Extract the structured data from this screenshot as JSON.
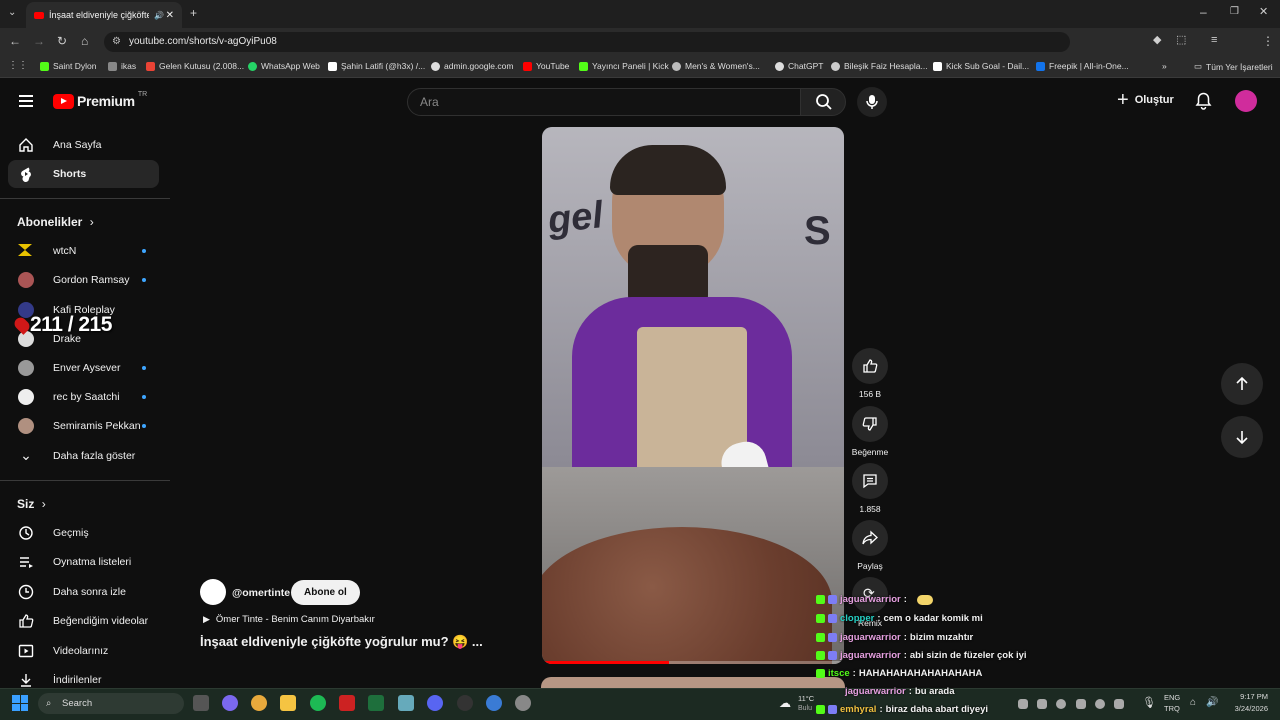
{
  "browser": {
    "tab_title": "İnşaat eldiveniyle çiğköfte y",
    "url": "youtube.com/shorts/v-agOyiPu08",
    "bookmarks": [
      {
        "label": "Saint Dylon",
        "color": "#53fc18"
      },
      {
        "label": "ikas",
        "color": "#888888"
      },
      {
        "label": "Gelen Kutusu (2.008...",
        "color": "#ea4335"
      },
      {
        "label": "WhatsApp Web",
        "color": "#25d366"
      },
      {
        "label": "Şahin Latifi (@h3x) /...",
        "color": "#ffffff"
      },
      {
        "label": "admin.google.com",
        "color": "#dddddd"
      },
      {
        "label": "YouTube",
        "color": "#ff0000"
      },
      {
        "label": "Yayıncı Paneli | Kick",
        "color": "#53fc18"
      },
      {
        "label": "Men's & Women's...",
        "color": "#bbbbbb"
      },
      {
        "label": "ChatGPT",
        "color": "#dddddd"
      },
      {
        "label": "Bileşik Faiz Hesapla...",
        "color": "#cccccc"
      },
      {
        "label": "Kick Sub Goal - Dail...",
        "color": "#ffffff"
      },
      {
        "label": "Freepik | All-in-One...",
        "color": "#1273eb"
      }
    ],
    "all_bookmarks": "Tüm Yer İşaretleri"
  },
  "header": {
    "logo": "Premium",
    "logo_region": "TR",
    "search_placeholder": "Ara",
    "create_label": "Oluştur"
  },
  "sidebar": {
    "main": [
      {
        "label": "Ana Sayfa",
        "icon": "home-icon"
      },
      {
        "label": "Shorts",
        "icon": "shorts-icon",
        "active": true
      }
    ],
    "subs_title": "Abonelikler",
    "subscriptions": [
      {
        "label": "wtcN",
        "dot": true,
        "color": "#e8c200"
      },
      {
        "label": "Gordon Ramsay",
        "dot": true,
        "color": "#a55"
      },
      {
        "label": "Kafi Roleplay",
        "dot": false,
        "color": "#333a88"
      },
      {
        "label": "Drake",
        "dot": false,
        "color": "#ddd"
      },
      {
        "label": "Enver Aysever",
        "dot": true,
        "color": "#999"
      },
      {
        "label": "rec by Saatchi",
        "dot": true,
        "color": "#eee"
      },
      {
        "label": "Semiramis Pekkan",
        "dot": true,
        "color": "#b09080"
      }
    ],
    "show_more": "Daha fazla göster",
    "you_title": "Siz",
    "you_items": [
      {
        "label": "Geçmiş",
        "icon": "history-icon"
      },
      {
        "label": "Oynatma listeleri",
        "icon": "playlist-icon"
      },
      {
        "label": "Daha sonra izle",
        "icon": "clock-icon"
      },
      {
        "label": "Beğendiğim videolar",
        "icon": "thumbs-up-icon"
      },
      {
        "label": "Videolarınız",
        "icon": "video-icon"
      },
      {
        "label": "İndirilenler",
        "icon": "download-icon"
      }
    ]
  },
  "overlay_counter": "211 / 215",
  "video": {
    "channel": "@omertinte",
    "subscribe": "Abone ol",
    "sound": "Ömer Tinte - Benim Canım Diyarbakır",
    "title": "İnşaat eldiveniyle çiğköfte yoğrulur mu? 😝 ...",
    "progress": 0.42,
    "likes": "156 B",
    "dislike_label": "Beğenme",
    "comments": "1.858",
    "share_label": "Paylaş",
    "remix_label": "Remix"
  },
  "chat": [
    {
      "user": "jaguarwarrior",
      "msg": "",
      "user_color": "#e6a0e0"
    },
    {
      "user": "clopper",
      "msg": "cem o kadar komik mi",
      "user_color": "#26d1c5"
    },
    {
      "user": "jaguarwarrior",
      "msg": "bizim mızahtır",
      "user_color": "#e6a0e0"
    },
    {
      "user": "jaguarwarrior",
      "msg": "abi sizin de füzeler çok iyi",
      "user_color": "#e6a0e0"
    },
    {
      "user": "itsce",
      "msg": "HAHAHAHAHAHAHAHAHA",
      "user_color": "#53fc18"
    },
    {
      "user": "jaguarwarrior",
      "msg": "bu arada",
      "user_color": "#e6a0e0"
    },
    {
      "user": "emhyral",
      "msg": "biraz daha abart diyeyi",
      "user_color": "#f0c040"
    }
  ],
  "taskbar": {
    "search": "Search",
    "weather_temp": "11°C",
    "weather_label": "Bulu",
    "lang": "ENG",
    "lang2": "TRQ",
    "time": "9:17 PM",
    "date": "3/24/2026"
  }
}
